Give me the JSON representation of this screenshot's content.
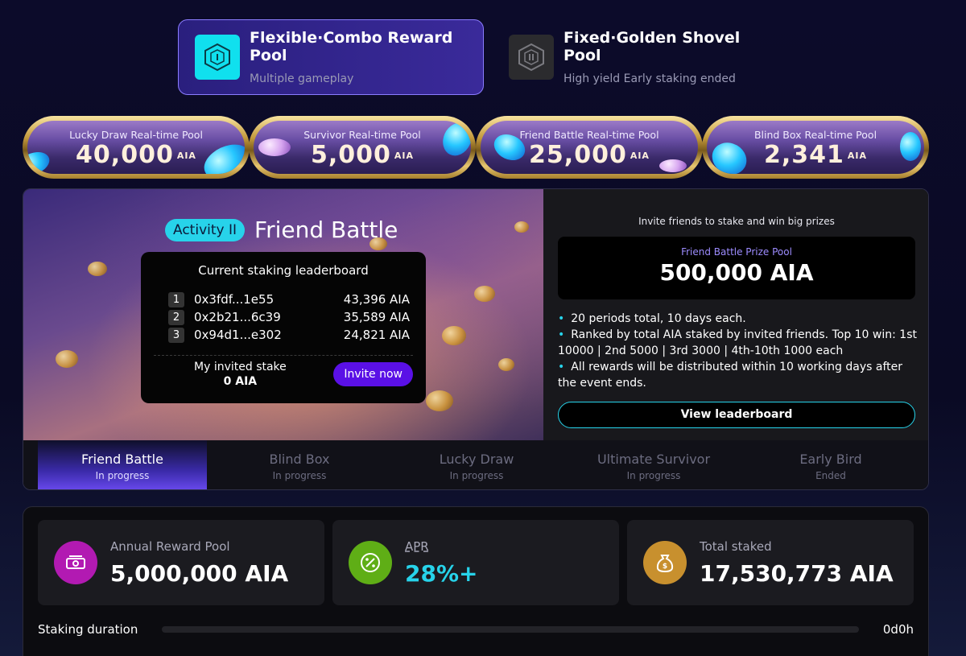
{
  "pools": {
    "flexible": {
      "title": "Flexible·Combo Reward Pool",
      "subtitle": "Multiple gameplay",
      "icon": "cube-icon-I"
    },
    "fixed": {
      "title": "Fixed·Golden Shovel Pool",
      "subtitle": "High yield Early staking ended",
      "icon": "cube-icon-II"
    }
  },
  "realtime": [
    {
      "label": "Lucky Draw Real-time Pool",
      "value": "40,000",
      "unit": "AIA"
    },
    {
      "label": "Survivor Real-time Pool",
      "value": "5,000",
      "unit": "AIA"
    },
    {
      "label": "Friend Battle Real-time Pool",
      "value": "25,000",
      "unit": "AIA"
    },
    {
      "label": "Blind Box Real-time Pool",
      "value": "2,341",
      "unit": "AIA"
    }
  ],
  "activity": {
    "badge": "Activity II",
    "title": "Friend Battle",
    "leaderboard": {
      "title": "Current staking leaderboard",
      "rows": [
        {
          "rank": "1",
          "address": "0x3fdf...1e55",
          "amount": "43,396 AIA"
        },
        {
          "rank": "2",
          "address": "0x2b21...6c39",
          "amount": "35,589 AIA"
        },
        {
          "rank": "3",
          "address": "0x94d1...e302",
          "amount": "24,821 AIA"
        }
      ],
      "my_label": "My invited stake",
      "my_value": "0 AIA",
      "invite_label": "Invite now"
    },
    "invite_caption": "Invite friends to stake and win big prizes",
    "prize_label": "Friend Battle Prize Pool",
    "prize_value": "500,000 AIA",
    "rules": [
      "20 periods total, 10 days each.",
      "Ranked by total AIA staked by invited friends. Top 10 win: 1st 10000 | 2nd 5000 | 3rd 3000 | 4th-10th 1000 each",
      "All rewards will be distributed within 10 working days after the event ends."
    ],
    "view_label": "View leaderboard",
    "tabs": [
      {
        "name": "Friend Battle",
        "status": "In progress"
      },
      {
        "name": "Blind Box",
        "status": "In progress"
      },
      {
        "name": "Lucky Draw",
        "status": "In progress"
      },
      {
        "name": "Ultimate Survivor",
        "status": "In progress"
      },
      {
        "name": "Early Bird",
        "status": "Ended"
      }
    ]
  },
  "stats": {
    "annual": {
      "label": "Annual Reward Pool",
      "value": "5,000,000 AIA",
      "icon": "money-stack-icon",
      "color": "#c21fc2"
    },
    "apr": {
      "label": "APR",
      "value": "28%+",
      "icon": "percent-icon",
      "color": "#6fc21a"
    },
    "total": {
      "label": "Total staked",
      "value": "17,530,773 AIA",
      "icon": "money-bag-icon",
      "color": "#d3a03a"
    }
  },
  "duration": {
    "label": "Staking duration",
    "value": "0d0h",
    "progress": 0
  },
  "colors": {
    "accent": "#27d3ea",
    "primary": "#5a10e6"
  }
}
